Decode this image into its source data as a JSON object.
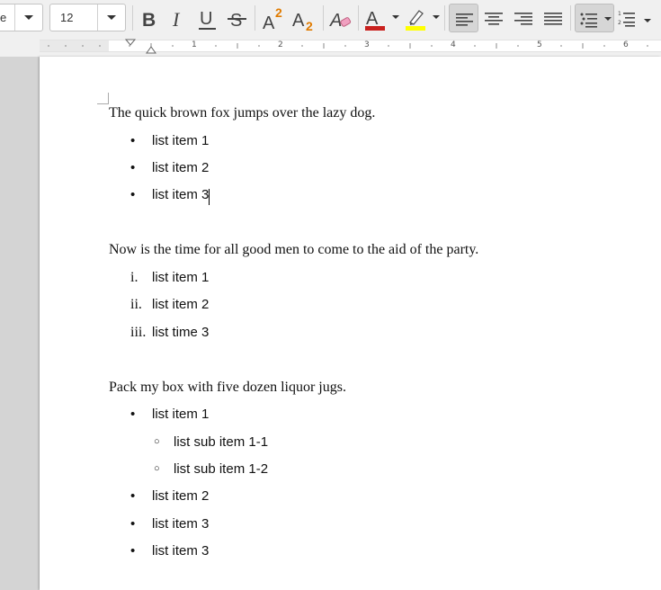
{
  "toolbar": {
    "font_name": "e",
    "font_size": "12",
    "font_color": "#c9211e",
    "highlight_color": "#ffff00",
    "icons": [
      "bold-icon",
      "italic-icon",
      "underline-icon",
      "strikethrough-icon",
      "superscript-icon",
      "subscript-icon",
      "clear-formatting-icon",
      "font-color-icon",
      "highlight-icon",
      "align-left-icon",
      "align-center-icon",
      "align-right-icon",
      "justify-icon",
      "bullet-list-icon",
      "numbered-list-icon"
    ]
  },
  "ruler": {
    "numbers": [
      "1",
      "2",
      "3",
      "4",
      "5",
      "6"
    ]
  },
  "document": {
    "para1": "The quick brown fox jumps over the lazy dog.",
    "list1": [
      "list item 1",
      "list item 2",
      "list item 3"
    ],
    "para2": "Now is the time for all good men to come to the aid of the party.",
    "list2_markers": [
      "i.",
      "ii.",
      "iii."
    ],
    "list2": [
      "list item 1",
      "list item 2",
      "list time 3"
    ],
    "para3": "Pack my box with five dozen liquor jugs.",
    "list3_a": "list item 1",
    "sublist": [
      "list sub item 1-1",
      "list sub item 1-2"
    ],
    "list3_b": [
      "list item 2",
      "list item 3",
      "list item 3"
    ],
    "bullet": "•",
    "sub_bullet": "○"
  }
}
